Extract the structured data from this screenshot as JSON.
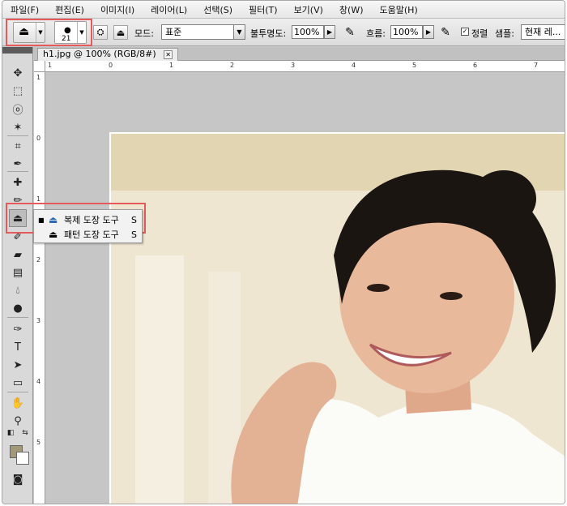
{
  "menubar": {
    "items": [
      "파일(F)",
      "편집(E)",
      "이미지(I)",
      "레이어(L)",
      "선택(S)",
      "필터(T)",
      "보기(V)",
      "창(W)",
      "도움말(H)"
    ]
  },
  "options": {
    "brush_size": "21",
    "mode_label": "모드:",
    "mode_value": "표준",
    "opacity_label": "불투명도:",
    "opacity_value": "100%",
    "flow_label": "흐름:",
    "flow_value": "100%",
    "aligned_label": "정렬",
    "sample_label": "샘플:",
    "sample_value": "현재 레..."
  },
  "document": {
    "tab_title": "h1.jpg @ 100% (RGB/8#)",
    "ruler_top": [
      "1",
      "0",
      "1",
      "2",
      "3",
      "4",
      "5",
      "6",
      "7"
    ],
    "ruler_left": [
      "1",
      "0",
      "1",
      "2",
      "3",
      "4",
      "5"
    ]
  },
  "flyout": {
    "items": [
      {
        "label": "복제 도장 도구",
        "key": "S",
        "icon": "clone-stamp-icon"
      },
      {
        "label": "패턴 도장 도구",
        "key": "S",
        "icon": "pattern-stamp-icon"
      }
    ]
  },
  "colors": {
    "foreground": "#a39976",
    "background": "#ffffff",
    "highlight": "#e55a5a"
  }
}
